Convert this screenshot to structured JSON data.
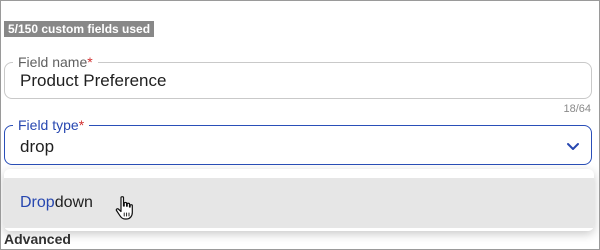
{
  "usage": {
    "text": "5/150 custom fields used"
  },
  "field_name": {
    "label": "Field name",
    "required_mark": "*",
    "value": "Product Preference",
    "counter": "18/64"
  },
  "field_type": {
    "label": "Field type",
    "required_mark": "*",
    "value": "drop",
    "icon": "chevron-down-icon"
  },
  "dropdown": {
    "options": [
      {
        "match": "Drop",
        "rest": "down"
      }
    ]
  },
  "background_section": {
    "label": "Advanced"
  },
  "colors": {
    "accent": "#2747b0",
    "required": "#d12f2f",
    "badge_bg": "#888888",
    "option_hover": "#e6e6e6"
  }
}
